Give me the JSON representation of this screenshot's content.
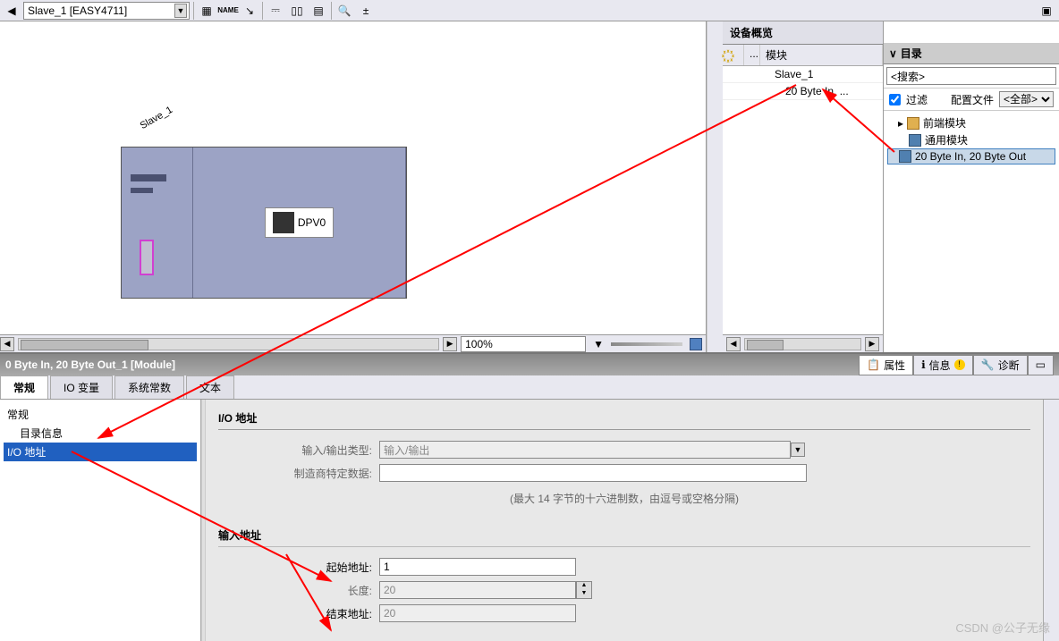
{
  "toolbar": {
    "device_dropdown": "Slave_1 [EASY4711]"
  },
  "canvas": {
    "device_label": "Slave_1",
    "chip_label": "DPV0",
    "zoom": "100%"
  },
  "overview": {
    "tab": "设备概览",
    "col_module": "模块",
    "rows": [
      {
        "name": "Slave_1"
      },
      {
        "name": "20 Byte In, ..."
      }
    ]
  },
  "catalog": {
    "title": "目录",
    "search_placeholder": "<搜索>",
    "filter_label": "过滤",
    "profile_label": "配置文件",
    "profile_value": "<全部>",
    "items": [
      {
        "label": "前端模块",
        "type": "folder"
      },
      {
        "label": "通用模块",
        "type": "module"
      },
      {
        "label": "20 Byte In, 20 Byte Out",
        "type": "module",
        "selected": true
      }
    ]
  },
  "bottom": {
    "title": "0 Byte In, 20 Byte Out_1 [Module]",
    "tabs_right": {
      "properties": "属性",
      "info": "信息",
      "diagnostics": "诊断"
    },
    "tabs": {
      "general": "常规",
      "io_vars": "IO 变量",
      "system_const": "系统常数",
      "text": "文本"
    },
    "nav": {
      "general": "常规",
      "catalog_info": "目录信息",
      "io_address": "I/O 地址"
    },
    "section": {
      "io_address": "I/O 地址",
      "io_type_label": "输入/输出类型:",
      "io_type_value": "输入/输出",
      "vendor_label": "制造商特定数据:",
      "hint": "(最大 14 字节的十六进制数，由逗号或空格分隔)",
      "input_addr": "输入地址",
      "start_addr_label": "起始地址:",
      "start_addr_value": "1",
      "length_label": "长度:",
      "length_value": "20",
      "end_addr_label": "结束地址:",
      "end_addr_value": "20"
    }
  },
  "watermark": "CSDN @公子无缘"
}
